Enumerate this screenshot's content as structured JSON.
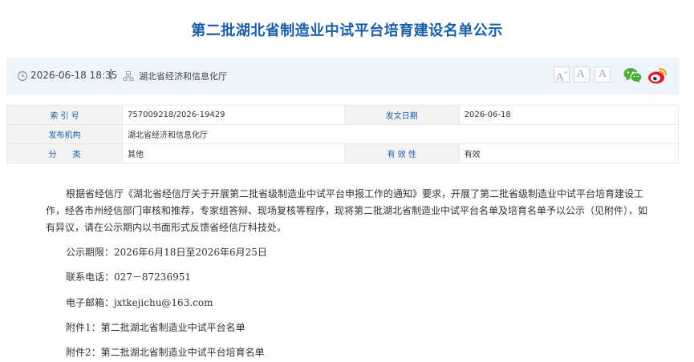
{
  "page": {
    "title": "第二批湖北省制造业中试平台培育建设名单公示"
  },
  "infobar": {
    "date": "2026-06-18 18:35",
    "separator": "|",
    "publisher": "湖北省经济和信息化厅",
    "font_large": "A",
    "font_large_mark": "+",
    "font_small": "A",
    "font_small_mark": "-",
    "font_reset": "A",
    "icons": [
      "clock-icon",
      "org-icon",
      "wechat-icon",
      "weibo-icon"
    ],
    "colors": {
      "wechat": "#4dad3a",
      "weibo": "#e6162d",
      "weibo_ring": "#f59d1d"
    }
  },
  "meta": {
    "index_label": "索 引 号",
    "index_value": "757009218/2026-19429",
    "date_label": "发文日期",
    "date_value": "2026-06-18",
    "org_label": "发布机构",
    "org_value": "湖北省经济和信息化厅",
    "category_label": "分　　类",
    "category_value": "其他",
    "validity_label": "有 效 性",
    "validity_value": "有效"
  },
  "content": {
    "paragraph": "根据省经信厅《湖北省经信厅关于开展第二批省级制造业中试平台申报工作的通知》要求，开展了第二批省级制造业中试平台培育建设工作，经各市州经信部门审核和推荐，专家组答辩、现场复核等程序，现将第二批湖北省制造业中试平台名单及培育名单予以公示（见附件），如有异议，请在公示期内以书面形式反馈省经信厅科技处。",
    "period": "公示期限：2026年6月18日至2026年6月25日",
    "phone": "联系电话：027－87236951",
    "email": "电子邮箱：jxtkejichu@163.com",
    "attachment1": "附件1：第二批湖北省制造业中试平台名单",
    "attachment2": "附件2：第二批湖北省制造业中试平台培育名单"
  },
  "colors": {
    "accent": "#1a5ea8",
    "infobar_bg": "#eef4fb"
  }
}
